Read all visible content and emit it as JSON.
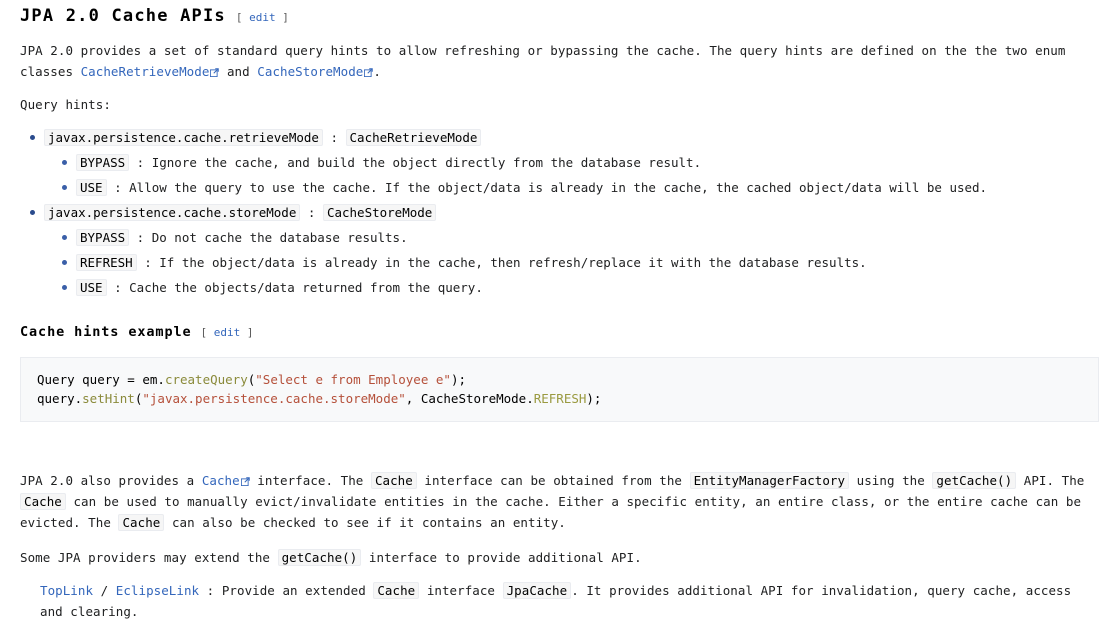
{
  "title": {
    "text": "JPA 2.0 Cache APIs",
    "edit_open": "[ ",
    "edit_label": "edit",
    "edit_close": " ]"
  },
  "intro": {
    "part1": "JPA 2.0 provides a set of standard query hints to allow refreshing or bypassing the cache. The query hints are defined on the the two enum classes ",
    "link1": "CacheRetrieveMode",
    "mid": " and ",
    "link2": "CacheStoreMode",
    "end": "."
  },
  "query_hints_label": "Query hints:",
  "hints": [
    {
      "name": "javax.persistence.cache.retrieveMode",
      "sep": " : ",
      "type": "CacheRetrieveMode",
      "values": [
        {
          "key": "BYPASS",
          "sep": " : ",
          "desc": "Ignore the cache, and build the object directly from the database result."
        },
        {
          "key": "USE",
          "sep": " : ",
          "desc": "Allow the query to use the cache. If the object/data is already in the cache, the cached object/data will be used."
        }
      ]
    },
    {
      "name": "javax.persistence.cache.storeMode",
      "sep": " : ",
      "type": "CacheStoreMode",
      "values": [
        {
          "key": "BYPASS",
          "sep": " : ",
          "desc": "Do not cache the database results."
        },
        {
          "key": "REFRESH",
          "sep": " : ",
          "desc": "If the object/data is already in the cache, then refresh/replace it with the database results."
        },
        {
          "key": "USE",
          "sep": " : ",
          "desc": "Cache the objects/data returned from the query."
        }
      ]
    }
  ],
  "example": {
    "heading": "Cache hints example",
    "edit_open": "[ ",
    "edit_label": "edit",
    "edit_close": " ]",
    "code": {
      "line1": {
        "a": "Query query = em.",
        "fn": "createQuery",
        "b": "(",
        "str": "\"Select e from Employee e\"",
        "c": ");"
      },
      "line2": {
        "a": "query.",
        "fn": "setHint",
        "b": "(",
        "str": "\"javax.persistence.cache.storeMode\"",
        "c": ", CacheStoreMode.",
        "const": "REFRESH",
        "d": ");"
      }
    }
  },
  "cache_para": {
    "p1": "JPA 2.0 also provides a ",
    "link": "Cache",
    "p2": " interface. The ",
    "code1": "Cache",
    "p3": " interface can be obtained from the ",
    "code2": "EntityManagerFactory",
    "p4": " using the ",
    "code3": "getCache()",
    "p5": " API. The ",
    "code4": "Cache",
    "p6": " can be used to manually evict/invalidate entities in the cache. Either a specific entity, an entire class, or the entire cache can be evicted. The ",
    "code5": "Cache",
    "p7": " can also be checked to see if it contains an entity."
  },
  "providers_para": {
    "p1": "Some JPA providers may extend the ",
    "code1": "getCache()",
    "p2": " interface to provide additional API."
  },
  "provider_item": {
    "link1": "TopLink",
    "slash": " / ",
    "link2": "EclipseLink",
    "p1": " : Provide an extended ",
    "code1": "Cache",
    "p2": " interface ",
    "code2": "JpaCache",
    "p3": ". It provides additional API for invalidation, query cache, access and clearing."
  },
  "colors": {
    "link": "#3366bb",
    "bullet": "#2a4b8d",
    "code_bg": "#f8f9fa",
    "code_border": "#eaecf0",
    "fn": "#8a8a3a",
    "string": "#b5503a",
    "constant": "#9a9a40"
  },
  "icons": {
    "external_link": "external-link-icon"
  }
}
